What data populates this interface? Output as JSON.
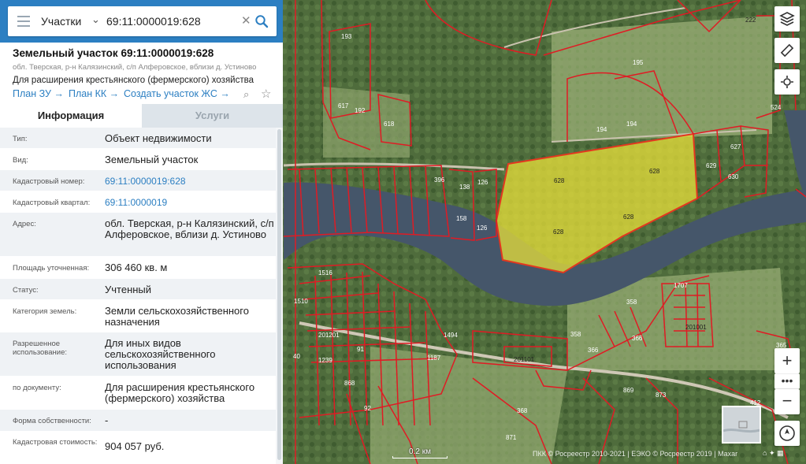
{
  "search": {
    "type_label": "Участки",
    "query": "69:11:0000019:628"
  },
  "card": {
    "title": "Земельный участок 69:11:0000019:628",
    "address_short": "обл. Тверская, р-н Калязинский, с/п Алферовское, вблизи д. Устиново",
    "purpose": "Для расширения крестьянского (фермерского) хозяйства",
    "links": {
      "plan_zu": "План ЗУ",
      "plan_kk": "План КК",
      "create_zhs": "Создать участок ЖС"
    }
  },
  "tabs": {
    "info": "Информация",
    "services": "Услуги"
  },
  "rows": [
    {
      "label": "Тип:",
      "value": "Объект недвижимости"
    },
    {
      "label": "Вид:",
      "value": "Земельный участок"
    },
    {
      "label": "Кадастровый номер:",
      "value": "69:11:0000019:628"
    },
    {
      "label": "Кадастровый квартал:",
      "value": "69:11:0000019"
    },
    {
      "label": "Адрес:",
      "value": "обл. Тверская, р-н Калязинский, с/п Алферовское, вблизи д. Устиново"
    },
    {
      "label": "Площадь уточненная:",
      "value": "306 460 кв. м"
    },
    {
      "label": "Статус:",
      "value": "Учтенный"
    },
    {
      "label": "Категория земель:",
      "value": "Земли сельскохозяйственного назначения"
    },
    {
      "label": "Разрешенное использование:",
      "value": "Для иных видов сельскохозяйственного использования"
    },
    {
      "label": "по документу:",
      "value": "Для расширения крестьянского (фермерского) хозяйства"
    },
    {
      "label": "Форма собственности:",
      "value": "-"
    },
    {
      "label": "Кадастровая стоимость:",
      "value": "904 057 руб."
    }
  ],
  "map": {
    "scale_label": "0.2 км",
    "attribution": "ПКК © Росреестр 2010-2021 | ЕЭКО © Росреестр 2019 | Maxar",
    "highlight_color": "#e8e03a",
    "boundary_color": "#e01b24",
    "parcel_labels": [
      "193",
      "195",
      "222",
      "524",
      "617",
      "192",
      "618",
      "194",
      "194",
      "627",
      "629",
      "630",
      "396",
      "138",
      "126",
      "628",
      "628",
      "628",
      "628",
      "158",
      "126",
      "1516",
      "1510",
      "1707",
      "358",
      "201001",
      "201201",
      "201101",
      "366",
      "366",
      "358",
      "365",
      "1494",
      "1187",
      "873",
      "412",
      "368",
      "871",
      "869",
      "868",
      "1239",
      "40",
      "91",
      "92"
    ]
  },
  "controls": {
    "zoom_in": "+",
    "more": "•••",
    "zoom_out": "−"
  }
}
